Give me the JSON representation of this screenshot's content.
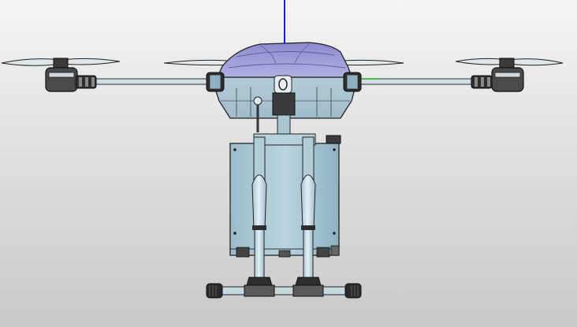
{
  "viewport": {
    "background_top": "#f4f4f4",
    "background_bottom": "#c9c9c9"
  },
  "model": {
    "shell_color": "#9a9ad8",
    "body_color": "#b6d2de",
    "tank_color": "#a8c8d6",
    "frame_color": "#2a2a2a",
    "arm_color": "#c8d8e0",
    "leg_color": "#c8dce8"
  },
  "triad": {
    "z_axis_color": "#1a1aff",
    "x_axis_color": "#22aa22"
  }
}
